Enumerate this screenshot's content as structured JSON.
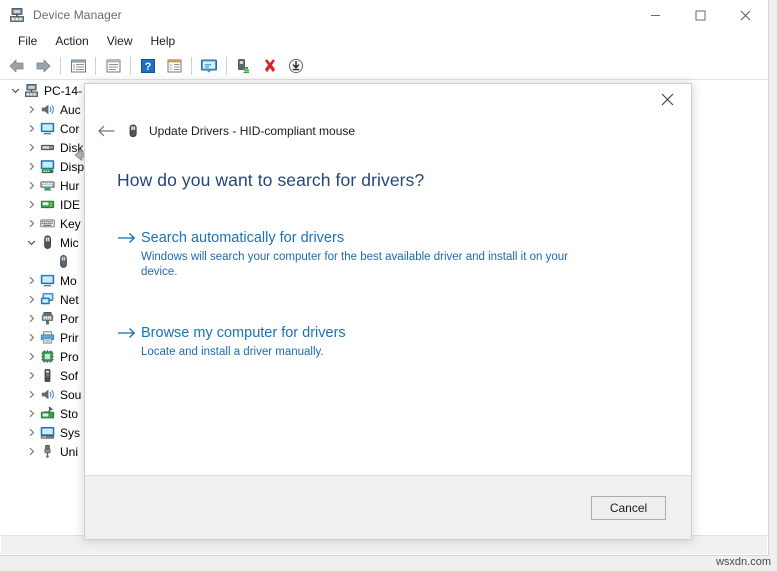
{
  "window": {
    "title": "Device Manager",
    "title_icon": "device-manager-icon",
    "controls": {
      "minimize": "minimize-icon",
      "maximize": "maximize-icon",
      "close": "close-icon"
    }
  },
  "menubar": {
    "items": [
      {
        "label": "File"
      },
      {
        "label": "Action"
      },
      {
        "label": "View"
      },
      {
        "label": "Help"
      }
    ]
  },
  "toolbar": {
    "buttons": [
      {
        "name": "back-icon"
      },
      {
        "name": "forward-icon"
      },
      {
        "name": "show-hide-console-tree-icon"
      },
      {
        "name": "properties-icon"
      },
      {
        "name": "help-icon"
      },
      {
        "name": "update-driver-icon"
      },
      {
        "name": "scan-for-hardware-changes-icon"
      },
      {
        "name": "enable-device-icon"
      },
      {
        "name": "uninstall-device-icon"
      },
      {
        "name": "install-legacy-hardware-icon"
      }
    ]
  },
  "tree": {
    "root": {
      "label": "PC-14-",
      "icon": "computer-icon",
      "expanded": true
    },
    "items": [
      {
        "label": "Auc",
        "icon": "audio-icon",
        "expandable": true,
        "indent": 1
      },
      {
        "label": "Cor",
        "icon": "computer-small-icon",
        "expandable": true,
        "indent": 1
      },
      {
        "label": "Disk",
        "icon": "disk-drive-icon",
        "expandable": true,
        "indent": 1
      },
      {
        "label": "Disp",
        "icon": "display-adapter-icon",
        "expandable": true,
        "indent": 1
      },
      {
        "label": "Hur",
        "icon": "human-interface-devices-icon",
        "expandable": true,
        "indent": 1
      },
      {
        "label": "IDE",
        "icon": "ide-controller-icon",
        "expandable": true,
        "indent": 1
      },
      {
        "label": "Key",
        "icon": "keyboard-icon",
        "expandable": true,
        "indent": 1
      },
      {
        "label": "Mic",
        "icon": "mouse-icon",
        "expandable": true,
        "expanded": true,
        "indent": 1
      },
      {
        "label": "",
        "icon": "hid-compliant-mouse-icon",
        "expandable": false,
        "indent": 2,
        "selected": false
      },
      {
        "label": "Mo",
        "icon": "monitor-icon",
        "expandable": true,
        "indent": 1
      },
      {
        "label": "Net",
        "icon": "network-adapter-icon",
        "expandable": true,
        "indent": 1
      },
      {
        "label": "Por",
        "icon": "ports-icon",
        "expandable": true,
        "indent": 1
      },
      {
        "label": "Prir",
        "icon": "print-queues-icon",
        "expandable": true,
        "indent": 1
      },
      {
        "label": "Pro",
        "icon": "processors-icon",
        "expandable": true,
        "indent": 1
      },
      {
        "label": "Sof",
        "icon": "software-devices-icon",
        "expandable": true,
        "indent": 1
      },
      {
        "label": "Sou",
        "icon": "sound-video-game-controllers-icon",
        "expandable": true,
        "indent": 1
      },
      {
        "label": "Sto",
        "icon": "storage-controllers-icon",
        "expandable": true,
        "indent": 1
      },
      {
        "label": "Sys",
        "icon": "system-devices-icon",
        "expandable": true,
        "indent": 1
      },
      {
        "label": "Uni",
        "icon": "usb-controllers-icon",
        "expandable": true,
        "indent": 1
      }
    ]
  },
  "dialog": {
    "close_icon": "close-icon",
    "back_icon": "back-arrow-icon",
    "title_icon": "mouse-device-icon",
    "title": "Update Drivers - HID-compliant mouse",
    "heading": "How do you want to search for drivers?",
    "options": [
      {
        "arrow_icon": "arrow-right-icon",
        "title": "Search automatically for drivers",
        "description": "Windows will search your computer for the best available driver and install it on your device."
      },
      {
        "arrow_icon": "arrow-right-icon",
        "title": "Browse my computer for drivers",
        "description": "Locate and install a driver manually."
      }
    ],
    "cancel_label": "Cancel"
  },
  "watermark": {
    "text": "wsxdn.com"
  },
  "colors": {
    "link": "#1873b8",
    "heading": "#26457b",
    "description": "#1d6cae",
    "window_bg": "#ffffff",
    "footer_bg": "#f0f0f0"
  }
}
